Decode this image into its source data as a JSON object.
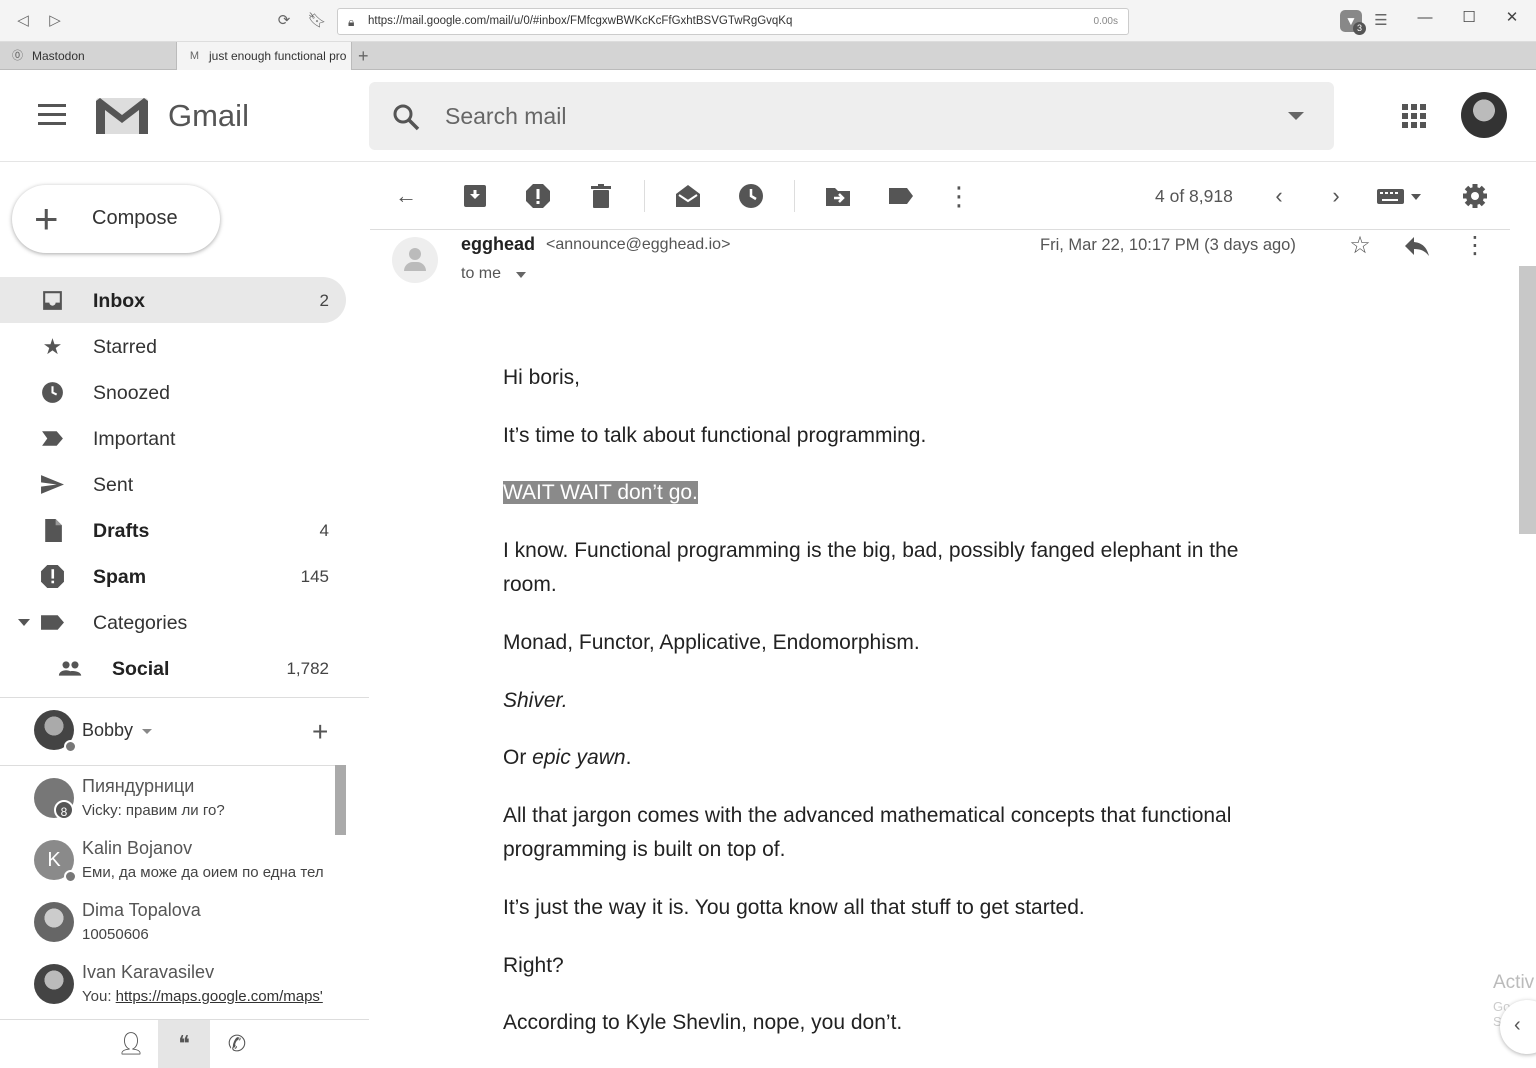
{
  "browser": {
    "url": "https://mail.google.com/mail/u/0/#inbox/FMfcgxwBWKcKcFfGxhtBSVGTwRgGvqKq",
    "load_time": "0.00s",
    "brave_badge": "3",
    "tabs": [
      {
        "label": "Mastodon",
        "active": false
      },
      {
        "label": "just enough functional pro",
        "active": true
      }
    ],
    "new_tab": "+"
  },
  "header": {
    "app_name": "Gmail",
    "search_placeholder": "Search mail"
  },
  "sidebar": {
    "compose_label": "Compose",
    "items": [
      {
        "label": "Inbox",
        "count": "2",
        "icon": "inbox-icon",
        "bold": true,
        "active": true
      },
      {
        "label": "Starred",
        "count": "",
        "icon": "star-icon",
        "bold": false
      },
      {
        "label": "Snoozed",
        "count": "",
        "icon": "clock-icon",
        "bold": false
      },
      {
        "label": "Important",
        "count": "",
        "icon": "important-icon",
        "bold": false
      },
      {
        "label": "Sent",
        "count": "",
        "icon": "send-icon",
        "bold": false
      },
      {
        "label": "Drafts",
        "count": "4",
        "icon": "draft-icon",
        "bold": true
      },
      {
        "label": "Spam",
        "count": "145",
        "icon": "spam-icon",
        "bold": true
      },
      {
        "label": "Categories",
        "count": "",
        "icon": "label-icon",
        "bold": false
      },
      {
        "label": "Social",
        "count": "1,782",
        "icon": "people-icon",
        "bold": true
      }
    ]
  },
  "hangouts": {
    "user_name": "Bobby",
    "chats": [
      {
        "name": "Пияндурници",
        "message": "Vicky: правим ли го?",
        "badge": "8"
      },
      {
        "name": "Kalin Bojanov",
        "message": "Еми, да може да оием по една тел",
        "initial": "K"
      },
      {
        "name": "Dima Topalova",
        "message": "10050606"
      },
      {
        "name": "Ivan Karavasilev",
        "message_prefix": "You: ",
        "message_link": "https://maps.google.com/maps'"
      }
    ]
  },
  "toolbar": {
    "pager": "4 of 8,918"
  },
  "message": {
    "sender_name": "egghead",
    "sender_email": "<announce@egghead.io>",
    "to": "to me",
    "date": "Fri, Mar 22, 10:17 PM (3 days ago)",
    "body": {
      "p1": "Hi boris,",
      "p2": "It’s time to talk about functional programming.",
      "p3": "WAIT WAIT don’t go.",
      "p4": "I know. Functional programming is the big, bad, possibly fanged elephant in the room.",
      "p5": "Monad, Functor, Applicative, Endomorphism.",
      "p6": "Shiver.",
      "p7_a": "Or ",
      "p7_b": "epic yawn",
      "p7_c": ".",
      "p8": "All that jargon comes with the advanced mathematical concepts that functional programming is built on top of.",
      "p9": "It’s just the way it is. You gotta know all that stuff to get started.",
      "p10": "Right?",
      "p11": "According to Kyle Shevlin, nope, you don’t."
    }
  },
  "watermark": {
    "line1": "Activ",
    "line2": "Go to S"
  }
}
